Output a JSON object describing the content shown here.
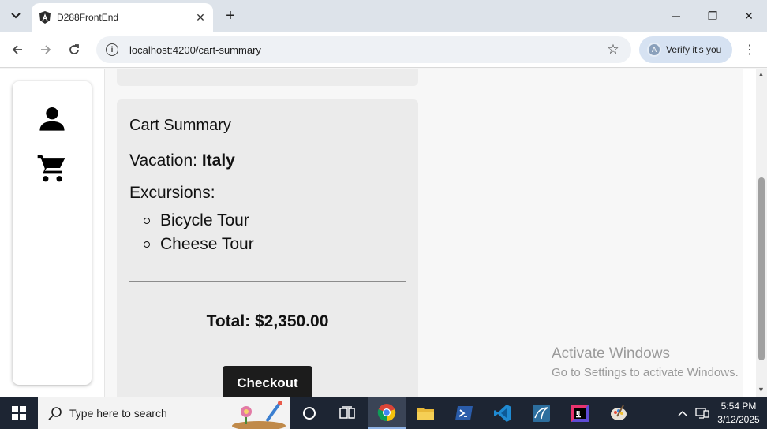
{
  "browser": {
    "tab_title": "D288FrontEnd",
    "tab_close": "✕",
    "new_tab": "+",
    "url": "localhost:4200/cart-summary",
    "verify_label": "Verify it's you",
    "avatar_letter": "A",
    "window_controls": {
      "minimize": "─",
      "restore": "❐",
      "close": "✕"
    }
  },
  "sidebar": {
    "items": [
      {
        "icon": "person-icon"
      },
      {
        "icon": "shopping-cart-icon"
      }
    ]
  },
  "cart": {
    "title": "Cart Summary",
    "vacation_label": "Vacation: ",
    "vacation_name": "Italy",
    "excursions_label": "Excursions:",
    "excursions": [
      "Bicycle Tour",
      "Cheese Tour"
    ],
    "total": "Total: $2,350.00",
    "checkout_label": "Checkout"
  },
  "watermark": {
    "line1": "Activate Windows",
    "line2": "Go to Settings to activate Windows."
  },
  "taskbar": {
    "search_placeholder": "Type here to search",
    "time": "5:54 PM",
    "date": "3/12/2025",
    "apps": [
      "task-view-icon",
      "chrome-icon",
      "file-explorer-icon",
      "powershell-icon",
      "vscode-icon",
      "mysql-workbench-icon",
      "intellij-icon",
      "paint-icon"
    ]
  },
  "colors": {
    "tabbar_bg": "#dde3ea",
    "card_bg": "#ebebeb",
    "checkout_bg": "#1c1c1c",
    "taskbar_bg": "#1d2533"
  }
}
